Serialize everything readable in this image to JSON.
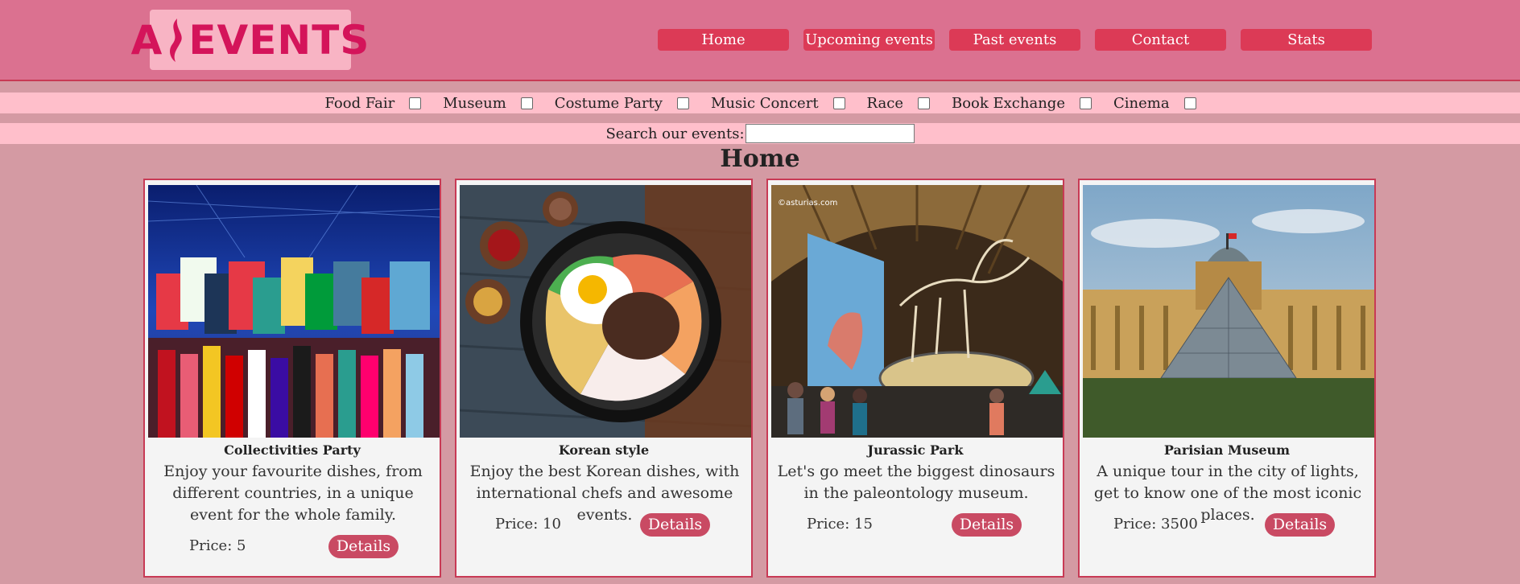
{
  "logo": {
    "left": "A",
    "right": "EVENTS"
  },
  "nav": [
    "Home",
    "Upcoming events",
    "Past events",
    "Contact",
    "Stats"
  ],
  "filters": [
    "Food Fair",
    "Museum",
    "Costume Party",
    "Music Concert",
    "Race",
    "Book Exchange",
    "Cinema"
  ],
  "search": {
    "label": "Search our events:",
    "value": ""
  },
  "page_title": "Home",
  "cards": [
    {
      "title": "Collectivities Party",
      "description": "Enjoy your favourite dishes, from different countries, in a unique event for the whole family.",
      "price": "Price: 5",
      "button": "Details"
    },
    {
      "title": "Korean style",
      "description": "Enjoy the best Korean dishes, with international chefs and awesome events.",
      "price": "Price: 10",
      "button": "Details"
    },
    {
      "title": "Jurassic Park",
      "description": "Let's go meet the biggest dinosaurs in the paleontology museum.",
      "price": "Price: 15",
      "button": "Details"
    },
    {
      "title": "Parisian Museum",
      "description": "A unique tour in the city of lights, get to know one of the most iconic places.",
      "price": "Price: 3500",
      "button": "Details"
    }
  ],
  "image_watermark": "©asturias.com",
  "colors": {
    "header": "#db7190",
    "accent": "#dc3a56",
    "band": "#ffbfcb",
    "button": "#c94a63"
  }
}
